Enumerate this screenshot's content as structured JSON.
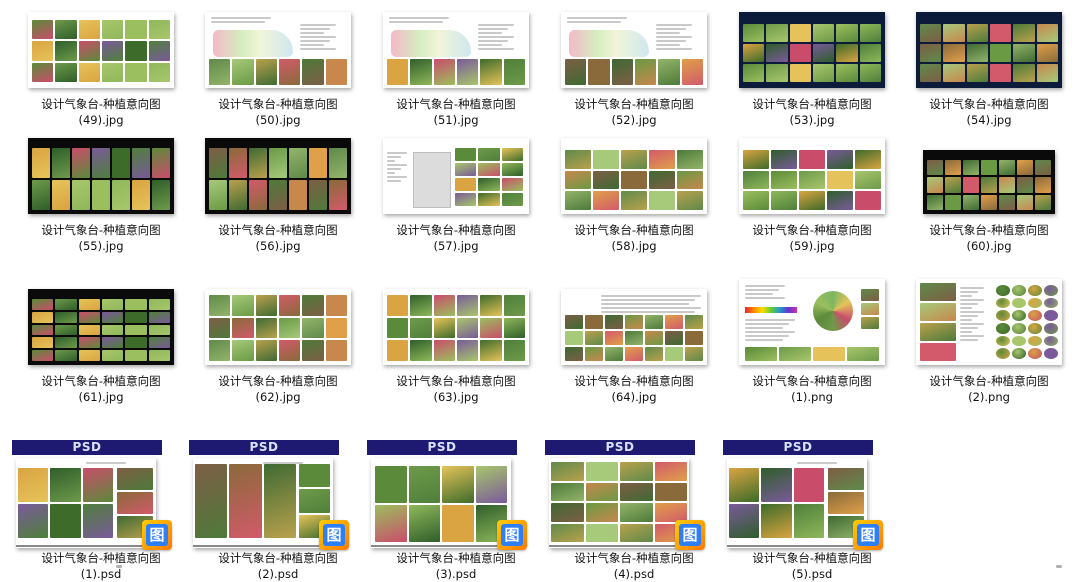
{
  "psd_badge_label": "PSD",
  "psd_icon_glyph": "图",
  "psd_icon": "photoshop-file-icon",
  "colors": {
    "psd_banner": "#1e1a72",
    "psd_banner_text": "#d7e2ff",
    "icon_frame_orange": "#ff9a00",
    "icon_blue": "#2d7ff9"
  },
  "files": [
    {
      "line1": "设计气象台-种植意向图",
      "line2": "(49).jpg"
    },
    {
      "line1": "设计气象台-种植意向图",
      "line2": "(50).jpg"
    },
    {
      "line1": "设计气象台-种植意向图",
      "line2": "(51).jpg"
    },
    {
      "line1": "设计气象台-种植意向图",
      "line2": "(52).jpg"
    },
    {
      "line1": "设计气象台-种植意向图",
      "line2": "(53).jpg"
    },
    {
      "line1": "设计气象台-种植意向图",
      "line2": "(54).jpg"
    },
    {
      "line1": "设计气象台-种植意向图",
      "line2": "(55).jpg"
    },
    {
      "line1": "设计气象台-种植意向图",
      "line2": "(56).jpg"
    },
    {
      "line1": "设计气象台-种植意向图",
      "line2": "(57).jpg"
    },
    {
      "line1": "设计气象台-种植意向图",
      "line2": "(58).jpg"
    },
    {
      "line1": "设计气象台-种植意向图",
      "line2": "(59).jpg"
    },
    {
      "line1": "设计气象台-种植意向图",
      "line2": "(60).jpg"
    },
    {
      "line1": "设计气象台-种植意向图",
      "line2": "(61).jpg"
    },
    {
      "line1": "设计气象台-种植意向图",
      "line2": "(62).jpg"
    },
    {
      "line1": "设计气象台-种植意向图",
      "line2": "(63).jpg"
    },
    {
      "line1": "设计气象台-种植意向图",
      "line2": "(64).jpg"
    },
    {
      "line1": "设计气象台-种植意向图",
      "line2": "(1).png"
    },
    {
      "line1": "设计气象台-种植意向图",
      "line2": "(2).png"
    },
    {
      "line1": "设计气象台-种植意向图",
      "line2": "(1).psd"
    },
    {
      "line1": "设计气象台-种植意向图",
      "line2": "(2).psd"
    },
    {
      "line1": "设计气象台-种植意向图",
      "line2": "(3).psd"
    },
    {
      "line1": "设计气象台-种植意向图",
      "line2": "(4).psd"
    },
    {
      "line1": "设计气象台-种植意向图",
      "line2": "(5).psd"
    }
  ]
}
